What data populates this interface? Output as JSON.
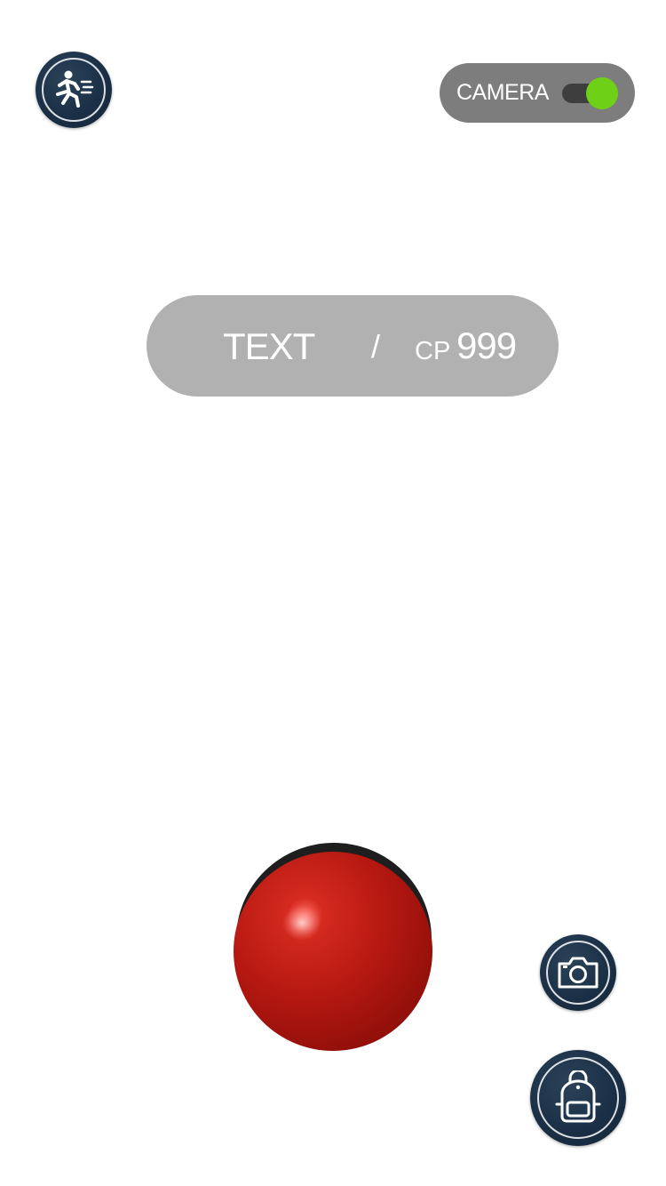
{
  "header": {
    "camera_toggle": {
      "label": "CAMERA",
      "enabled": true,
      "on_color": "#6fd117"
    }
  },
  "encounter": {
    "name": "TEXT",
    "separator": "/",
    "cp_label": "CP",
    "cp_value": "999"
  },
  "icons": {
    "run": "running-figure-icon",
    "photo": "camera-icon",
    "bag": "backpack-icon",
    "ball": "red-ball"
  },
  "colors": {
    "button_bg": "#1b3046",
    "pill_bg": "#b1b1b1",
    "toggle_bg": "#7d7d7d",
    "ball_red": "#c0160f"
  }
}
